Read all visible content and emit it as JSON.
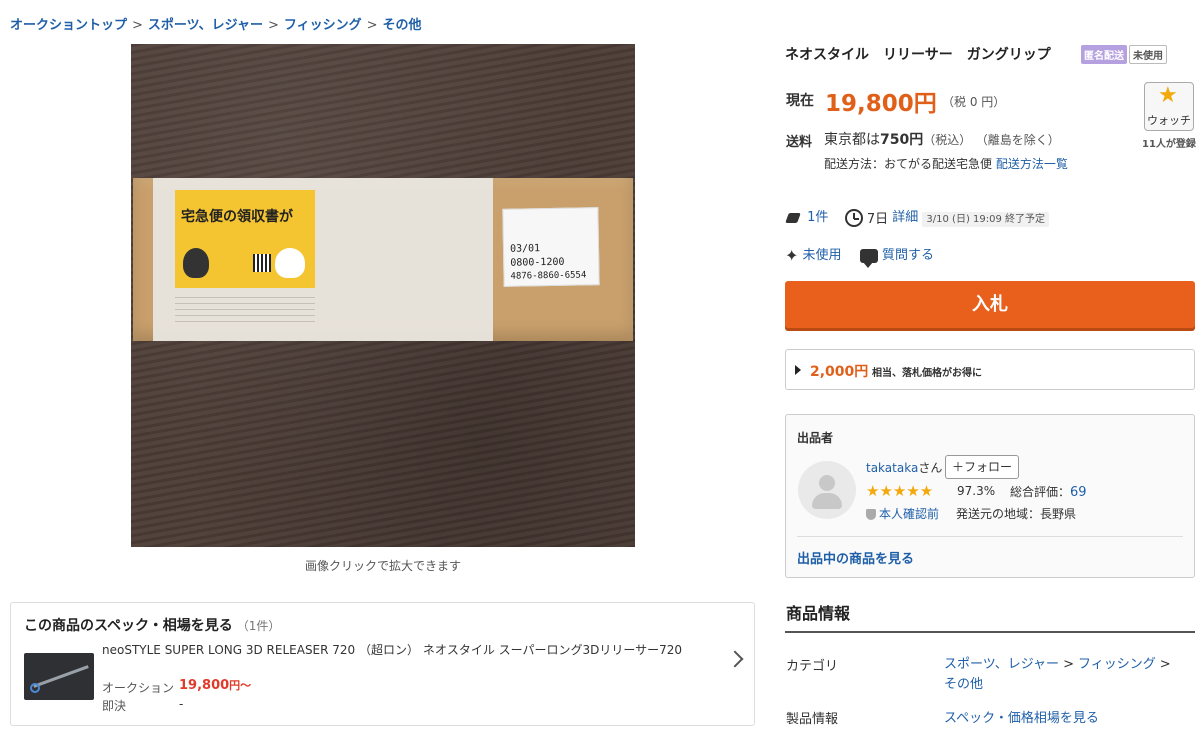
{
  "breadcrumb": [
    "オークショントップ",
    "スポーツ、レジャー",
    "フィッシング",
    "その他"
  ],
  "breadcrumb_sep": ">",
  "photo": {
    "caption": "画像クリックで拡大できます",
    "slip_title": "宅急便の領収書が",
    "label_lines": [
      "03/01",
      "0800-1200",
      "4876-8860-6554"
    ]
  },
  "spec": {
    "heading": "この商品のスペック・相場を見る",
    "count": "（1件）",
    "product_name": "neoSTYLE SUPER LONG 3D RELEASER 720 （超ロン） ネオスタイル スーパーロング3Dリリーサー720",
    "auction_label": "オークション",
    "auction_price": "19,800",
    "auction_suffix": "円〜",
    "bin_label": "即決",
    "bin_value": "-"
  },
  "item": {
    "title": "ネオスタイル　リリーサー　ガングリップ",
    "badge_anonymous": "匿名配送",
    "badge_condition": "未使用",
    "price_label": "現在",
    "price": "19,800円",
    "price_tax": "（税 0 円）",
    "watch_label": "ウォッチ",
    "watch_count": "11人が登録",
    "shipping_label": "送料",
    "shipping_region": "東京都は",
    "shipping_fee": "750円",
    "shipping_tax": "（税込）",
    "shipping_except": "（離島を除く）",
    "shipping_method": "配送方法：おてがる配送宅急便",
    "shipping_method_link": "配送方法一覧",
    "bids": "1件",
    "time_left": "7日",
    "details_link": "詳細",
    "end_time": "3/10 (日) 19:09 終了予定",
    "condition": "未使用",
    "question_link": "質問する",
    "bid_button": "入札",
    "save_amount": "2,000円",
    "save_text": "相当、落札価格がお得に"
  },
  "seller": {
    "heading": "出品者",
    "name": "takataka",
    "suffix": "さん",
    "follow_button": "＋フォロー",
    "stars": "★★★★★",
    "rating_pct": "97.3%",
    "total_label": "総合評価：",
    "total_value": "69",
    "verify": "本人確認前",
    "region": "発送元の地域：長野県",
    "items_link": "出品中の商品を見る"
  },
  "product_info": {
    "heading": "商品情報",
    "category_label": "カテゴリ",
    "category_path": [
      "スポーツ、レジャー",
      "フィッシング",
      "その他"
    ],
    "category_sep": ">",
    "spec_label": "製品情報",
    "spec_link": "スペック・価格相場を見る"
  },
  "colors": {
    "accent": "#e8601c",
    "link": "#1f5fa8",
    "star": "#f2a90c"
  }
}
